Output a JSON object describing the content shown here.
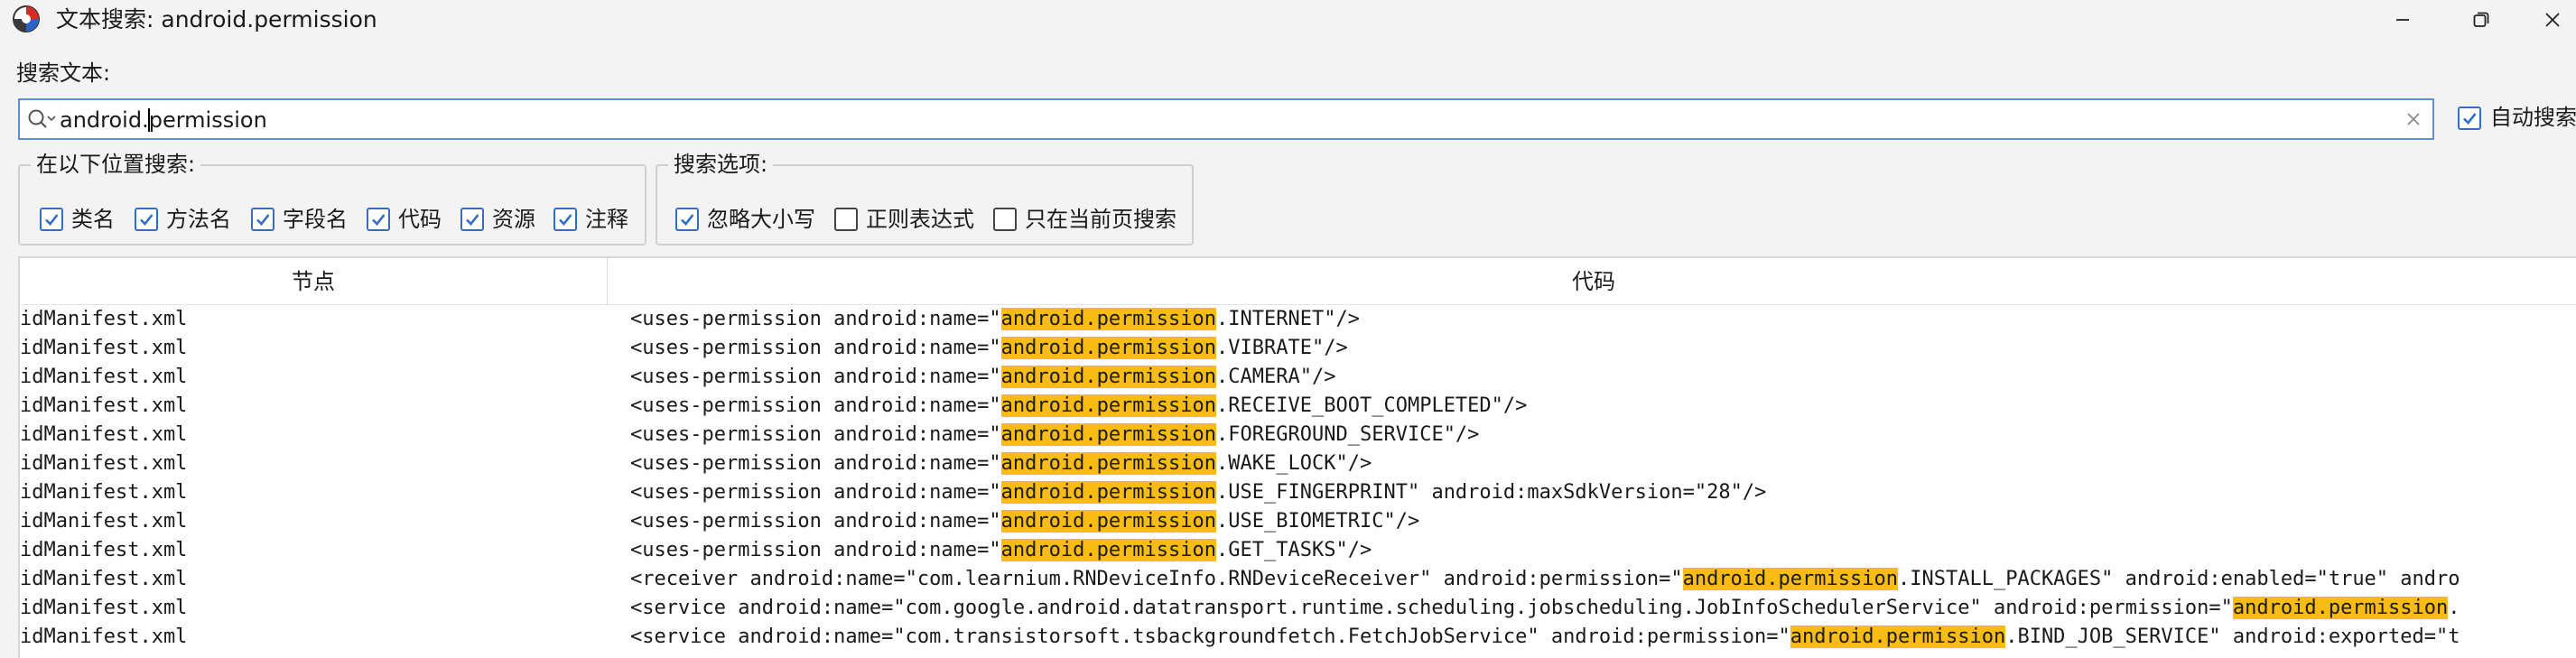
{
  "window": {
    "title": "文本搜索: android.permission",
    "minimize_icon": "minimize-icon",
    "maximize_icon": "maximize-icon",
    "close_icon": "close-icon"
  },
  "search": {
    "label": "搜索文本:",
    "value_before_caret": "android.",
    "value_after_caret": "permission",
    "auto_search_label": "自动搜索",
    "auto_search_checked": true
  },
  "location_group": {
    "title": "在以下位置搜索:",
    "options": [
      {
        "label": "类名",
        "checked": true
      },
      {
        "label": "方法名",
        "checked": true
      },
      {
        "label": "字段名",
        "checked": true
      },
      {
        "label": "代码",
        "checked": true
      },
      {
        "label": "资源",
        "checked": true
      },
      {
        "label": "注释",
        "checked": true
      }
    ]
  },
  "search_options_group": {
    "title": "搜索选项:",
    "options": [
      {
        "label": "忽略大小写",
        "checked": true
      },
      {
        "label": "正则表达式",
        "checked": false
      },
      {
        "label": "只在当前页搜索",
        "checked": false
      }
    ]
  },
  "results": {
    "columns": {
      "node": "节点",
      "code": "代码"
    },
    "highlight_color": "#f9bc12",
    "rows": [
      {
        "node": "idManifest.xml",
        "code_before": "<uses-permission android:name=\"",
        "match": "android.permission",
        "code_after": ".INTERNET\"/>"
      },
      {
        "node": "idManifest.xml",
        "code_before": "<uses-permission android:name=\"",
        "match": "android.permission",
        "code_after": ".VIBRATE\"/>"
      },
      {
        "node": "idManifest.xml",
        "code_before": "<uses-permission android:name=\"",
        "match": "android.permission",
        "code_after": ".CAMERA\"/>"
      },
      {
        "node": "idManifest.xml",
        "code_before": "<uses-permission android:name=\"",
        "match": "android.permission",
        "code_after": ".RECEIVE_BOOT_COMPLETED\"/>"
      },
      {
        "node": "idManifest.xml",
        "code_before": "<uses-permission android:name=\"",
        "match": "android.permission",
        "code_after": ".FOREGROUND_SERVICE\"/>"
      },
      {
        "node": "idManifest.xml",
        "code_before": "<uses-permission android:name=\"",
        "match": "android.permission",
        "code_after": ".WAKE_LOCK\"/>"
      },
      {
        "node": "idManifest.xml",
        "code_before": "<uses-permission android:name=\"",
        "match": "android.permission",
        "code_after": ".USE_FINGERPRINT\" android:maxSdkVersion=\"28\"/>"
      },
      {
        "node": "idManifest.xml",
        "code_before": "<uses-permission android:name=\"",
        "match": "android.permission",
        "code_after": ".USE_BIOMETRIC\"/>"
      },
      {
        "node": "idManifest.xml",
        "code_before": "<uses-permission android:name=\"",
        "match": "android.permission",
        "code_after": ".GET_TASKS\"/>"
      },
      {
        "node": "idManifest.xml",
        "code_before": "<receiver android:name=\"com.learnium.RNDeviceInfo.RNDeviceReceiver\" android:permission=\"",
        "match": "android.permission",
        "code_after": ".INSTALL_PACKAGES\" android:enabled=\"true\" andro"
      },
      {
        "node": "idManifest.xml",
        "code_before": "<service android:name=\"com.google.android.datatransport.runtime.scheduling.jobscheduling.JobInfoSchedulerService\" android:permission=\"",
        "match": "android.permission",
        "code_after": "."
      },
      {
        "node": "idManifest.xml",
        "code_before": "<service android:name=\"com.transistorsoft.tsbackgroundfetch.FetchJobService\" android:permission=\"",
        "match": "android.permission",
        "code_after": ".BIND_JOB_SERVICE\" android:exported=\"t"
      }
    ]
  }
}
